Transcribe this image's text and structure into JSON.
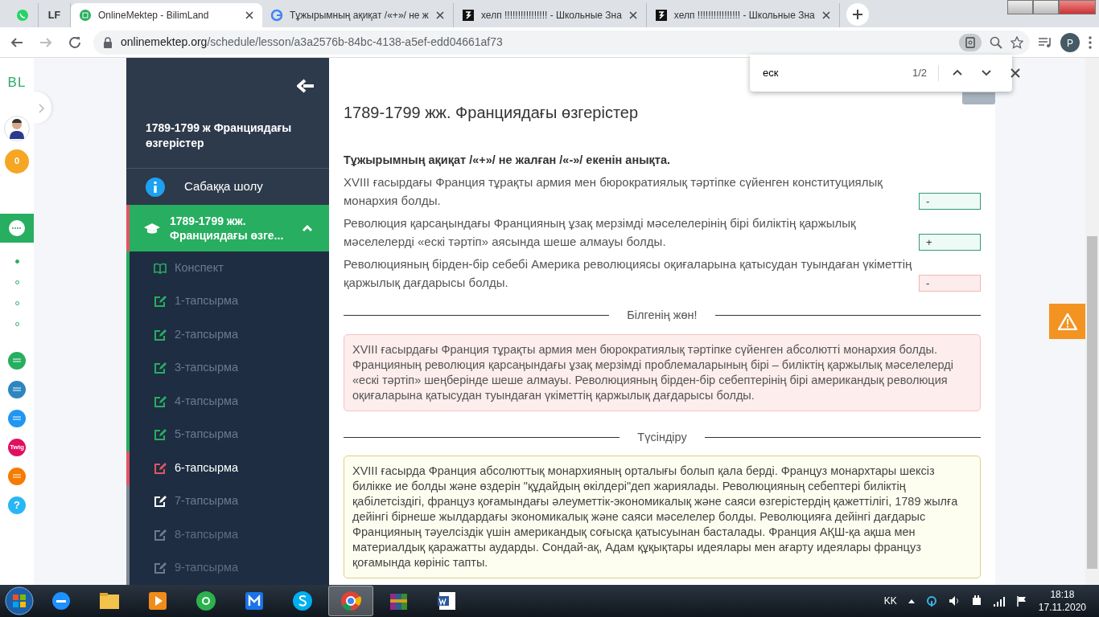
{
  "browser": {
    "tabs": [
      {
        "kind": "pinned",
        "selected": false
      },
      {
        "kind": "pinned",
        "title": "LF",
        "selected": false
      },
      {
        "kind": "normal",
        "title": "OnlineMektep - BilimLand",
        "selected": true
      },
      {
        "kind": "normal",
        "title": "Тұжырымның ақиқат /«+»/ не ж",
        "selected": false
      },
      {
        "kind": "normal",
        "title": "хелп !!!!!!!!!!!!!!!! - Школьные Зна",
        "selected": false
      },
      {
        "kind": "normal",
        "title": "хелп !!!!!!!!!!!!!!!! - Школьные Зна",
        "selected": false
      }
    ],
    "url": {
      "domain": "onlinemektep.org",
      "path": "/schedule/lesson/a3a2576b-84bc-4138-a5ef-edd04661af73"
    },
    "profile": "P"
  },
  "find_bar": {
    "query": "еск",
    "count": "1/2"
  },
  "rail": {
    "logo": "BL",
    "coins": "0",
    "dots": [
      {
        "selected": true
      },
      {
        "selected": false
      },
      {
        "selected": false
      },
      {
        "selected": false
      }
    ],
    "apps": [
      {
        "kind": "land",
        "color": "#27ae60"
      },
      {
        "kind": "book",
        "color": "#2e86c1"
      },
      {
        "kind": "test",
        "color": "#2196f3"
      },
      {
        "kind": "twig",
        "color": "#e0115f",
        "label": "Twig"
      },
      {
        "kind": "mektep",
        "color": "#f57c00"
      },
      {
        "kind": "help",
        "color": "#29b6f6",
        "label": "?"
      }
    ]
  },
  "sidebar": {
    "title": "1789-1799 ж Франциядағы өзгерістер",
    "overview": "Сабаққа шолу",
    "section": {
      "title": "1789-1799 жж. Франциядағы өзге...",
      "expanded": true
    },
    "items": [
      {
        "kind": "notes",
        "label": "Конспект",
        "done": true,
        "selected": false,
        "locked": false
      },
      {
        "kind": "task",
        "label": "1-тапсырма",
        "done": true,
        "selected": false,
        "locked": false
      },
      {
        "kind": "task",
        "label": "2-тапсырма",
        "done": true,
        "selected": false,
        "locked": false
      },
      {
        "kind": "task",
        "label": "3-тапсырма",
        "done": true,
        "selected": false,
        "locked": false
      },
      {
        "kind": "task",
        "label": "4-тапсырма",
        "done": true,
        "selected": false,
        "locked": false
      },
      {
        "kind": "task",
        "label": "5-тапсырма",
        "done": true,
        "selected": false,
        "locked": false
      },
      {
        "kind": "task",
        "label": "6-тапсырма",
        "done": false,
        "selected": true,
        "locked": false
      },
      {
        "kind": "task",
        "label": "7-тапсырма",
        "done": false,
        "selected": false,
        "locked": false
      },
      {
        "kind": "task",
        "label": "8-тапсырма",
        "done": false,
        "selected": false,
        "locked": true
      },
      {
        "kind": "task",
        "label": "9-тапсырма",
        "done": false,
        "selected": false,
        "locked": true
      }
    ]
  },
  "lesson": {
    "title": "1789-1799 жж. Франциядағы өзгерістер",
    "instruction": "Тұжырымның ақиқат /«+»/ не жалған /«-»/ екенін анықта.",
    "statements": [
      {
        "text": "XVIII ғасырдағы Франция тұрақты армия мен бюрократиялық тәртіпке сүйенген конституциялық монархия болды.",
        "answer": "-",
        "correct": true
      },
      {
        "text": "Революция қарсаңындағы Францияның ұзақ мерзімді мәселелерінің бірі биліктің қаржылық мәселелерді «ескі тәртіп» аясында шеше алмауы болды.",
        "answer": "+",
        "correct": true
      },
      {
        "text": "Революцияның бірден-бір себебі Америка революциясы оқиғаларына қатысудан туындаған үкіметтің қаржылық дағдарысы болды.",
        "answer": "-",
        "correct": false
      }
    ],
    "sections": [
      {
        "kind": "fact",
        "heading": "Білгенің жөн!",
        "text": "XVIII ғасырдағы Франция тұрақты армия мен бюрократиялық тәртіпке сүйенген абсолютті монархия болды. Францияның революция қарсаңындағы ұзақ мерзімді проблемаларының бірі – биліктің қаржылық мәселелерді «ескі тәртіп» шеңберінде шеше алмауы. Революцияның бірден-бір себептерінің бірі американдық революция оқиғаларына қатысудан туындаған үкіметтің қаржылық дағдарысы болды."
      },
      {
        "kind": "explain",
        "heading": "Түсіндіру",
        "text": "XVIII ғасырда Франция абсолюттық монархияның орталығы болып қала берді. Француз монархтары шексіз билікке ие болды және өздерін \"құдайдың өкілдері\"деп жариялады. Революцияның себептері биліктің қабілетсіздігі, француз қоғамындағы әлеуметтік-экономикалық және саяси өзгерістердің қажеттілігі, 1789 жылға дейінгі бірнеше жылдардағы экономикалық және саяси мәселелер болды. Революцияға дейінгі дағдарыс Францияның тәуелсіздік үшін американдық соғысқа қатысуынан басталады. Франция АҚШ-қа ақша мен материалдық қаражатты аударды. Сондай-ақ, Адам құқықтары идеялары мен ағарту идеялары француз қоғамында көрініс тапты."
      }
    ]
  },
  "taskbar": {
    "apps": [
      {
        "kind": "ie",
        "selected": false
      },
      {
        "kind": "folder",
        "selected": false
      },
      {
        "kind": "media",
        "selected": false
      },
      {
        "kind": "mail",
        "selected": false
      },
      {
        "kind": "maxthon",
        "selected": false
      },
      {
        "kind": "skype",
        "selected": false
      },
      {
        "kind": "chrome",
        "selected": true
      },
      {
        "kind": "archive",
        "selected": false
      },
      {
        "kind": "word",
        "selected": false
      }
    ],
    "language": "KK",
    "time": "18:18",
    "date": "17.11.2020"
  }
}
